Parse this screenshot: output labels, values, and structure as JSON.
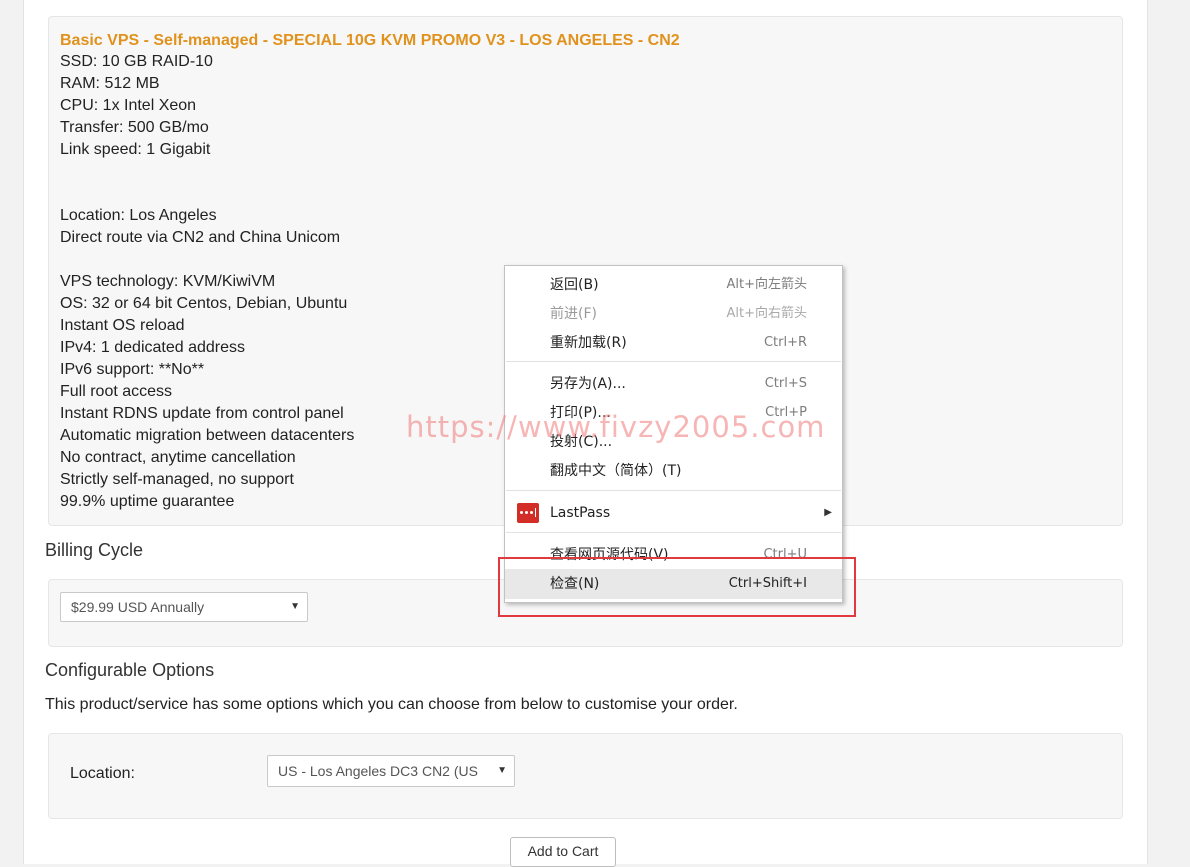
{
  "product": {
    "title": "Basic VPS - Self-managed - SPECIAL 10G KVM PROMO V3 - LOS ANGELES - CN2",
    "specs": [
      "SSD: 10 GB RAID-10",
      "RAM: 512 MB",
      "CPU: 1x Intel Xeon",
      "Transfer: 500 GB/mo",
      "Link speed: 1 Gigabit",
      "Location: Los Angeles",
      "Direct route via CN2 and China Unicom",
      "VPS technology: KVM/KiwiVM",
      "OS: 32 or 64 bit Centos, Debian, Ubuntu",
      "Instant OS reload",
      "IPv4: 1 dedicated address",
      "IPv6 support: **No**",
      "Full root access",
      "Instant RDNS update from control panel",
      "Automatic migration between datacenters",
      "No contract, anytime cancellation",
      "Strictly self-managed, no support",
      "99.9% uptime guarantee"
    ]
  },
  "billing": {
    "heading": "Billing Cycle",
    "selected": "$29.99 USD Annually"
  },
  "config": {
    "heading": "Configurable Options",
    "description": "This product/service has some options which you can choose from below to customise your order.",
    "location_label": "Location:",
    "location_selected": "US - Los Angeles DC3 CN2 (US"
  },
  "add_to_cart_label": "Add to Cart",
  "context_menu": {
    "items": [
      {
        "label": "返回(B)",
        "shortcut": "Alt+向左箭头",
        "disabled": false
      },
      {
        "label": "前进(F)",
        "shortcut": "Alt+向右箭头",
        "disabled": true
      },
      {
        "label": "重新加载(R)",
        "shortcut": "Ctrl+R",
        "disabled": false
      },
      {
        "label": "另存为(A)...",
        "shortcut": "Ctrl+S",
        "disabled": false
      },
      {
        "label": "打印(P)...",
        "shortcut": "Ctrl+P",
        "disabled": false
      },
      {
        "label": "投射(C)...",
        "shortcut": "",
        "disabled": false
      },
      {
        "label": "翻成中文（简体）(T)",
        "shortcut": "",
        "disabled": false
      },
      {
        "label": "LastPass",
        "shortcut": "",
        "disabled": false
      },
      {
        "label": "查看网页源代码(V)",
        "shortcut": "Ctrl+U",
        "disabled": false
      },
      {
        "label": "检查(N)",
        "shortcut": "Ctrl+Shift+I",
        "disabled": false,
        "highlighted": true
      }
    ]
  },
  "watermark": "https://www.fivzy2005.com",
  "colors": {
    "title_accent": "#e0921d",
    "highlight_box": "#e0393e",
    "lastpass_red": "#d22d27"
  },
  "icons": {
    "lastpass": "lastpass-icon",
    "submenu": "chevron-right-icon",
    "dropdown": "caret-down-icon"
  }
}
